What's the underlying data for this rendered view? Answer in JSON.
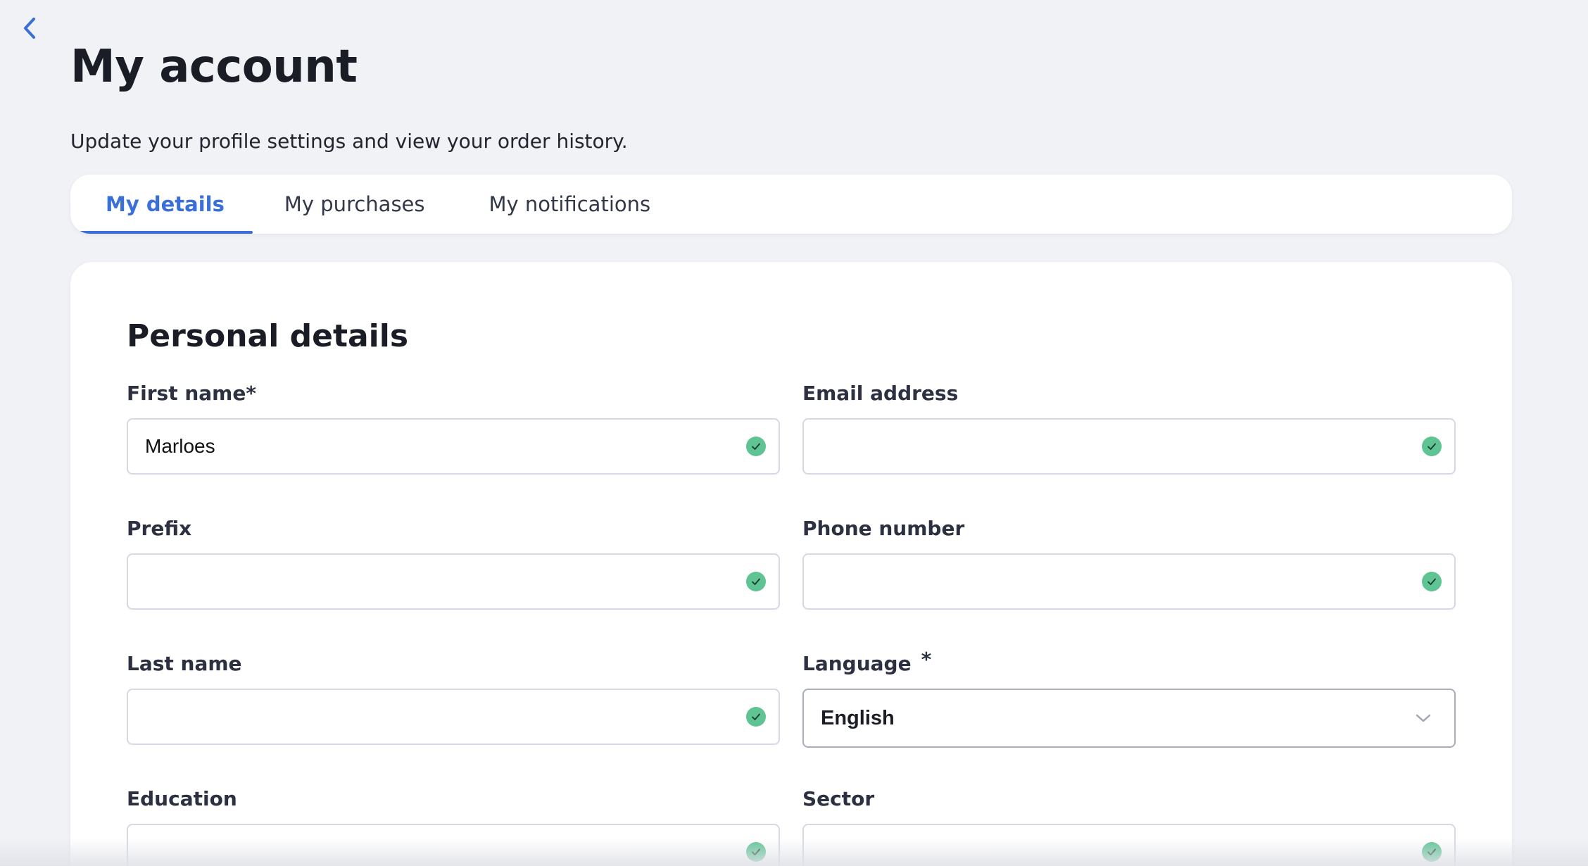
{
  "page": {
    "title": "My account",
    "subtitle": "Update your profile settings and view your order history."
  },
  "tabs": [
    {
      "label": "My details",
      "active": true
    },
    {
      "label": "My purchases",
      "active": false
    },
    {
      "label": "My notifications",
      "active": false
    }
  ],
  "section": {
    "title": "Personal details"
  },
  "fields": {
    "first_name": {
      "label": "First name*",
      "value": "Marloes",
      "valid": true
    },
    "email": {
      "label": "Email address",
      "value": "",
      "valid": true
    },
    "prefix": {
      "label": "Prefix",
      "value": "",
      "valid": true
    },
    "phone": {
      "label": "Phone number",
      "value": "",
      "valid": true
    },
    "last_name": {
      "label": "Last name",
      "value": "",
      "valid": true
    },
    "language": {
      "label": "Language",
      "required_mark": "*",
      "value": "English"
    },
    "education": {
      "label": "Education",
      "value": "",
      "valid": true
    },
    "sector": {
      "label": "Sector",
      "value": "",
      "valid": true
    }
  },
  "icons": {
    "back": "chevron-left-icon",
    "valid": "check-circle-icon",
    "dropdown": "chevron-down-icon"
  },
  "colors": {
    "accent": "#3b6fd8",
    "valid": "#5fc494",
    "background": "#f1f2f6"
  }
}
